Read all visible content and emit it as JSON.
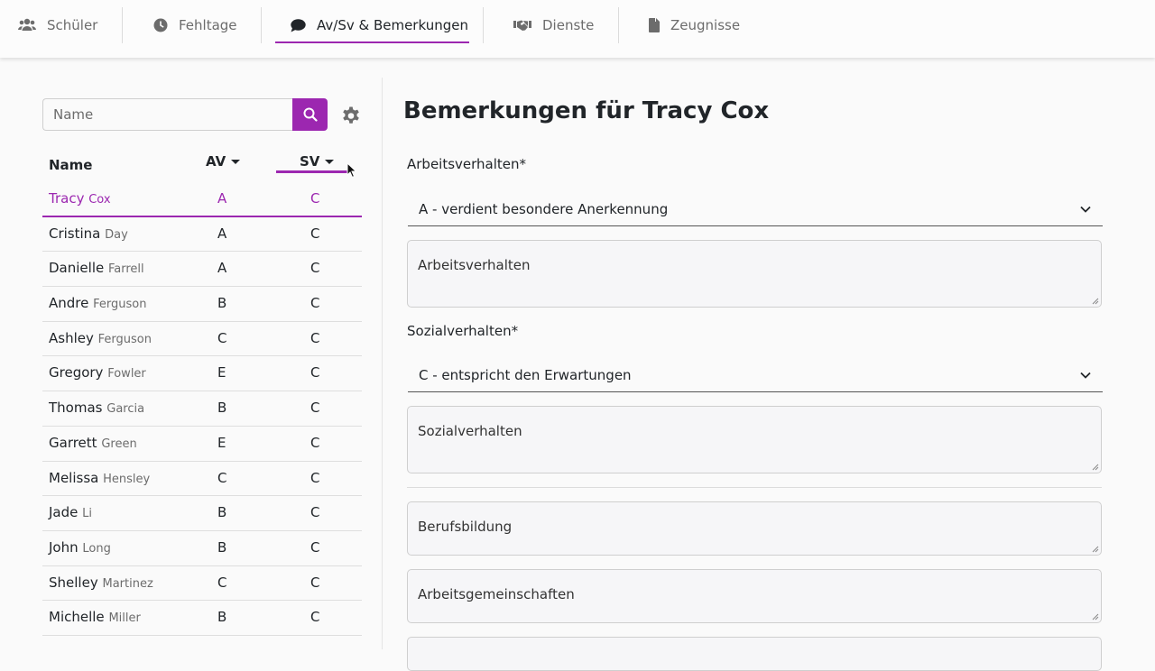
{
  "tabs": [
    {
      "label": "Schüler",
      "icon": "users-icon"
    },
    {
      "label": "Fehltage",
      "icon": "clock-icon"
    },
    {
      "label": "Av/Sv & Bemerkungen",
      "icon": "comment-icon",
      "active": true
    },
    {
      "label": "Dienste",
      "icon": "handshake-icon"
    },
    {
      "label": "Zeugnisse",
      "icon": "file-icon"
    }
  ],
  "search": {
    "placeholder": "Name"
  },
  "table": {
    "headers": {
      "name": "Name",
      "av": "AV",
      "sv": "SV"
    },
    "rows": [
      {
        "first": "Tracy",
        "last": "Cox",
        "av": "A",
        "sv": "C",
        "selected": true
      },
      {
        "first": "Cristina",
        "last": "Day",
        "av": "A",
        "sv": "C"
      },
      {
        "first": "Danielle",
        "last": "Farrell",
        "av": "A",
        "sv": "C"
      },
      {
        "first": "Andre",
        "last": "Ferguson",
        "av": "B",
        "sv": "C"
      },
      {
        "first": "Ashley",
        "last": "Ferguson",
        "av": "C",
        "sv": "C"
      },
      {
        "first": "Gregory",
        "last": "Fowler",
        "av": "E",
        "sv": "C"
      },
      {
        "first": "Thomas",
        "last": "Garcia",
        "av": "B",
        "sv": "C"
      },
      {
        "first": "Garrett",
        "last": "Green",
        "av": "E",
        "sv": "C"
      },
      {
        "first": "Melissa",
        "last": "Hensley",
        "av": "C",
        "sv": "C"
      },
      {
        "first": "Jade",
        "last": "Li",
        "av": "B",
        "sv": "C"
      },
      {
        "first": "John",
        "last": "Long",
        "av": "B",
        "sv": "C"
      },
      {
        "first": "Shelley",
        "last": "Martinez",
        "av": "C",
        "sv": "C"
      },
      {
        "first": "Michelle",
        "last": "Miller",
        "av": "B",
        "sv": "C"
      }
    ]
  },
  "main": {
    "title": "Bemerkungen für Tracy Cox",
    "av_label": "Arbeitsverhalten*",
    "av_value": "A - verdient besondere Anerkennung",
    "av_text_placeholder": "Arbeitsverhalten",
    "sv_label": "Sozialverhalten*",
    "sv_value": "C - entspricht den Erwartungen",
    "sv_text_placeholder": "Sozialverhalten",
    "berufsbildung_placeholder": "Berufsbildung",
    "ag_placeholder": "Arbeitsgemeinschaften"
  },
  "colors": {
    "accent": "#9c27b0"
  }
}
